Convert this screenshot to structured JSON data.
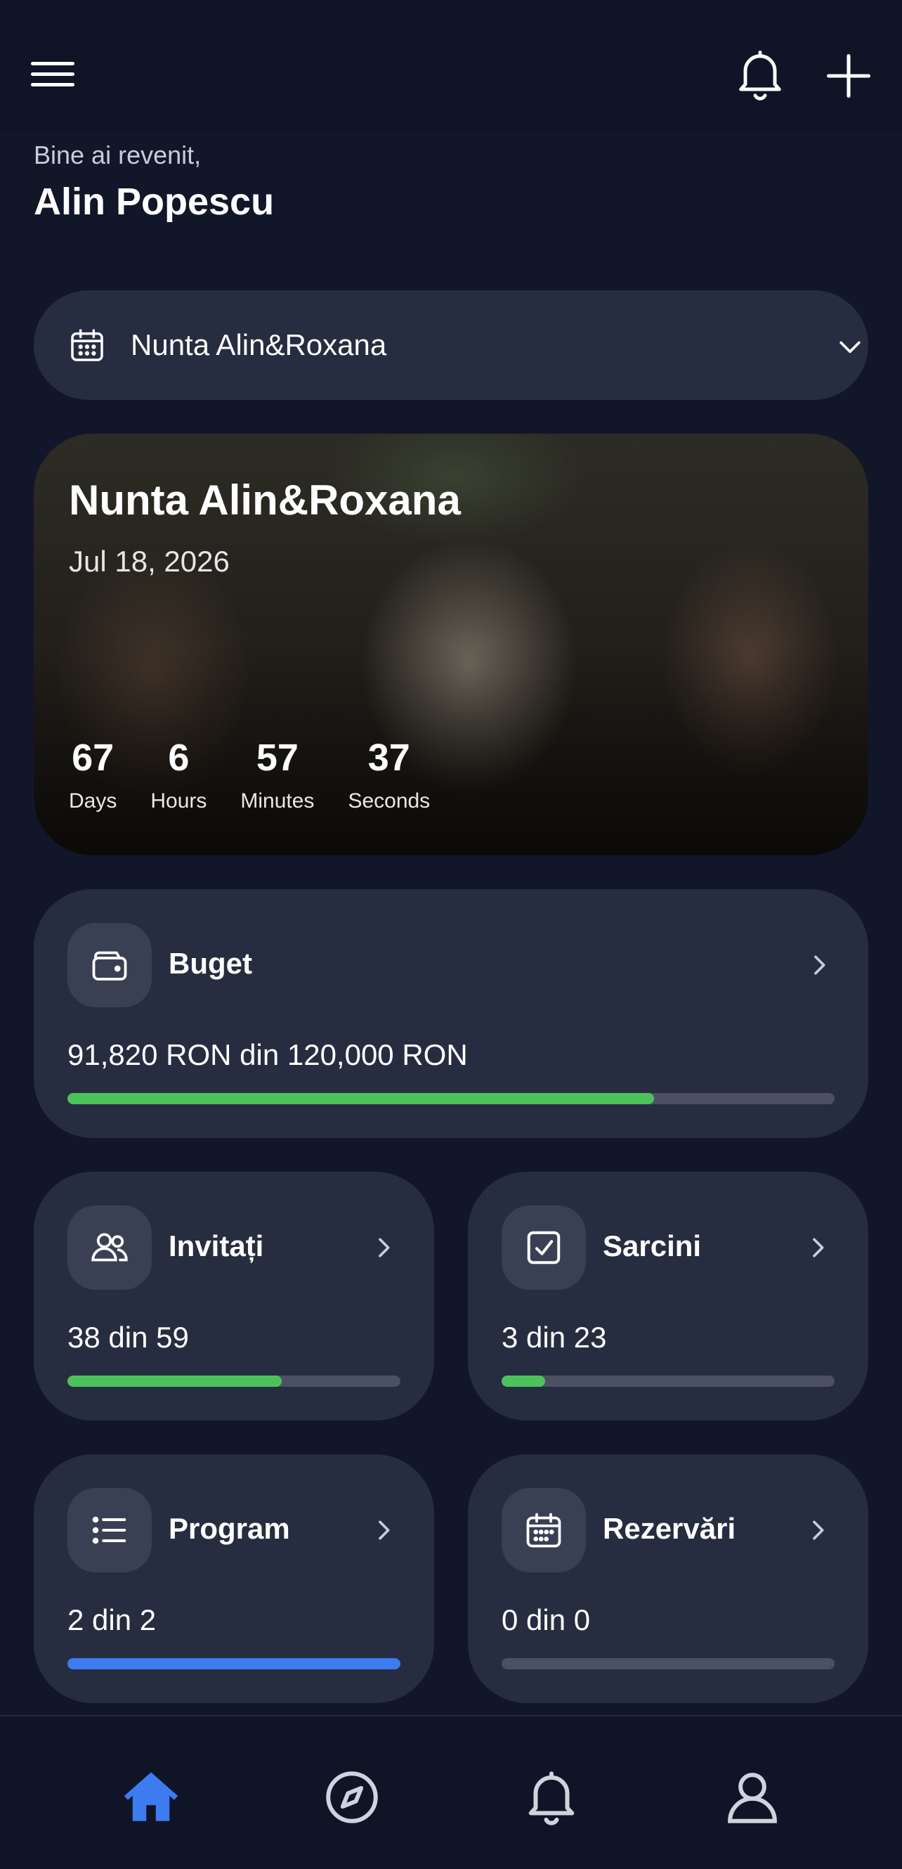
{
  "topbar": {
    "menu_icon": "hamburger-menu-icon",
    "bell_icon": "bell-icon",
    "plus_icon": "plus-icon"
  },
  "greeting": {
    "subtitle": "Bine ai revenit,",
    "name": "Alin Popescu"
  },
  "event_selector": {
    "icon": "calendar-icon",
    "selected": "Nunta Alin&Roxana",
    "chevron_icon": "chevron-down-icon"
  },
  "hero": {
    "title": "Nunta Alin&Roxana",
    "date": "Jul 18, 2026",
    "countdown": [
      {
        "value": "67",
        "label": "Days"
      },
      {
        "value": "6",
        "label": "Hours"
      },
      {
        "value": "57",
        "label": "Minutes"
      },
      {
        "value": "37",
        "label": "Seconds"
      }
    ]
  },
  "cards": {
    "budget": {
      "title": "Buget",
      "icon": "wallet-icon",
      "value": "91,820 RON din 120,000 RON",
      "progress": 0.765,
      "color": "#4cc35a"
    },
    "guests": {
      "title": "Invitați",
      "icon": "users-icon",
      "value": "38 din 59",
      "progress": 0.644,
      "color": "#4cc35a"
    },
    "tasks": {
      "title": "Sarcini",
      "icon": "checkbox-icon",
      "value": "3 din 23",
      "progress": 0.13,
      "color": "#4cc35a"
    },
    "program": {
      "title": "Program",
      "icon": "list-icon",
      "value": "2 din 2",
      "progress": 1.0,
      "color": "#3d7bf0"
    },
    "reservations": {
      "title": "Rezervări",
      "icon": "calendar-grid-icon",
      "value": "0 din 0",
      "progress": 0.0,
      "color": "#4b5163"
    }
  },
  "bottom_nav": {
    "items": [
      {
        "icon": "home-icon",
        "active": true
      },
      {
        "icon": "compass-icon",
        "active": false
      },
      {
        "icon": "bell-icon",
        "active": false
      },
      {
        "icon": "user-icon",
        "active": false
      }
    ],
    "active_color": "#3d7bf0",
    "inactive_color": "#cfd3de"
  }
}
